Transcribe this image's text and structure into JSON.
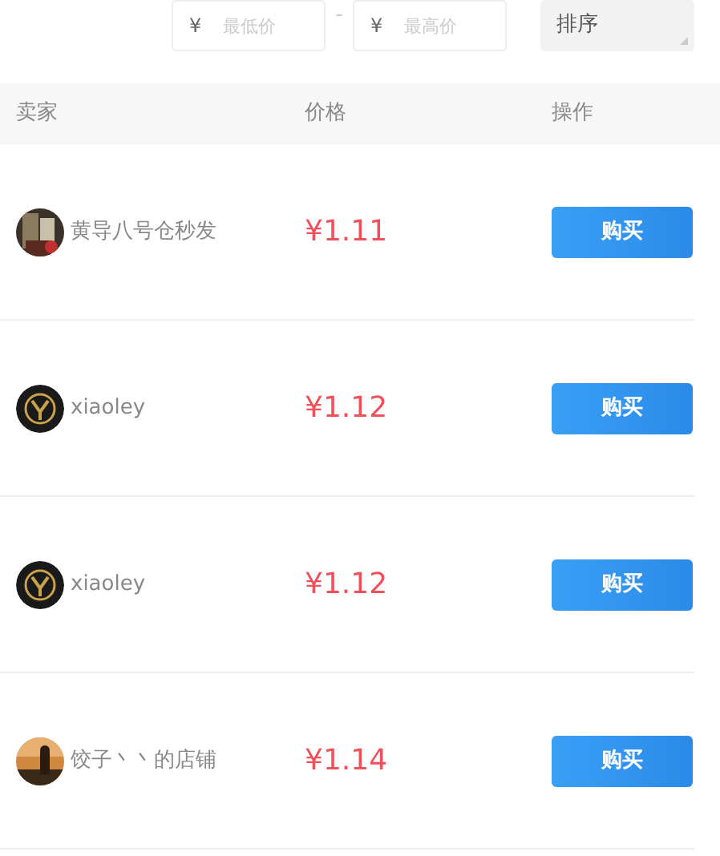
{
  "filter": {
    "min_price": {
      "prefix": "¥",
      "placeholder": "最低价"
    },
    "separator": "-",
    "max_price": {
      "prefix": "¥",
      "placeholder": "最高价"
    },
    "sort": {
      "label": "排序"
    }
  },
  "table": {
    "columns": [
      "卖家",
      "价格",
      "操作"
    ],
    "rows": [
      {
        "seller": "黄导八号仓秒发",
        "price": "¥1.11",
        "action": "购买"
      },
      {
        "avatar": {
          "kind": "logo"
        },
        "seller": "xiaoley",
        "price": "¥1.12",
        "action": "购买"
      },
      {
        "avatar": {
          "kind": "logo"
        },
        "seller": "xiaoley",
        "price": "¥1.12",
        "action": "购买"
      },
      {
        "avatar": {
          "kind": "sunset"
        },
        "seller": "饺子丶丶的店铺",
        "price": "¥1.14",
        "action": "购买"
      }
    ]
  }
}
